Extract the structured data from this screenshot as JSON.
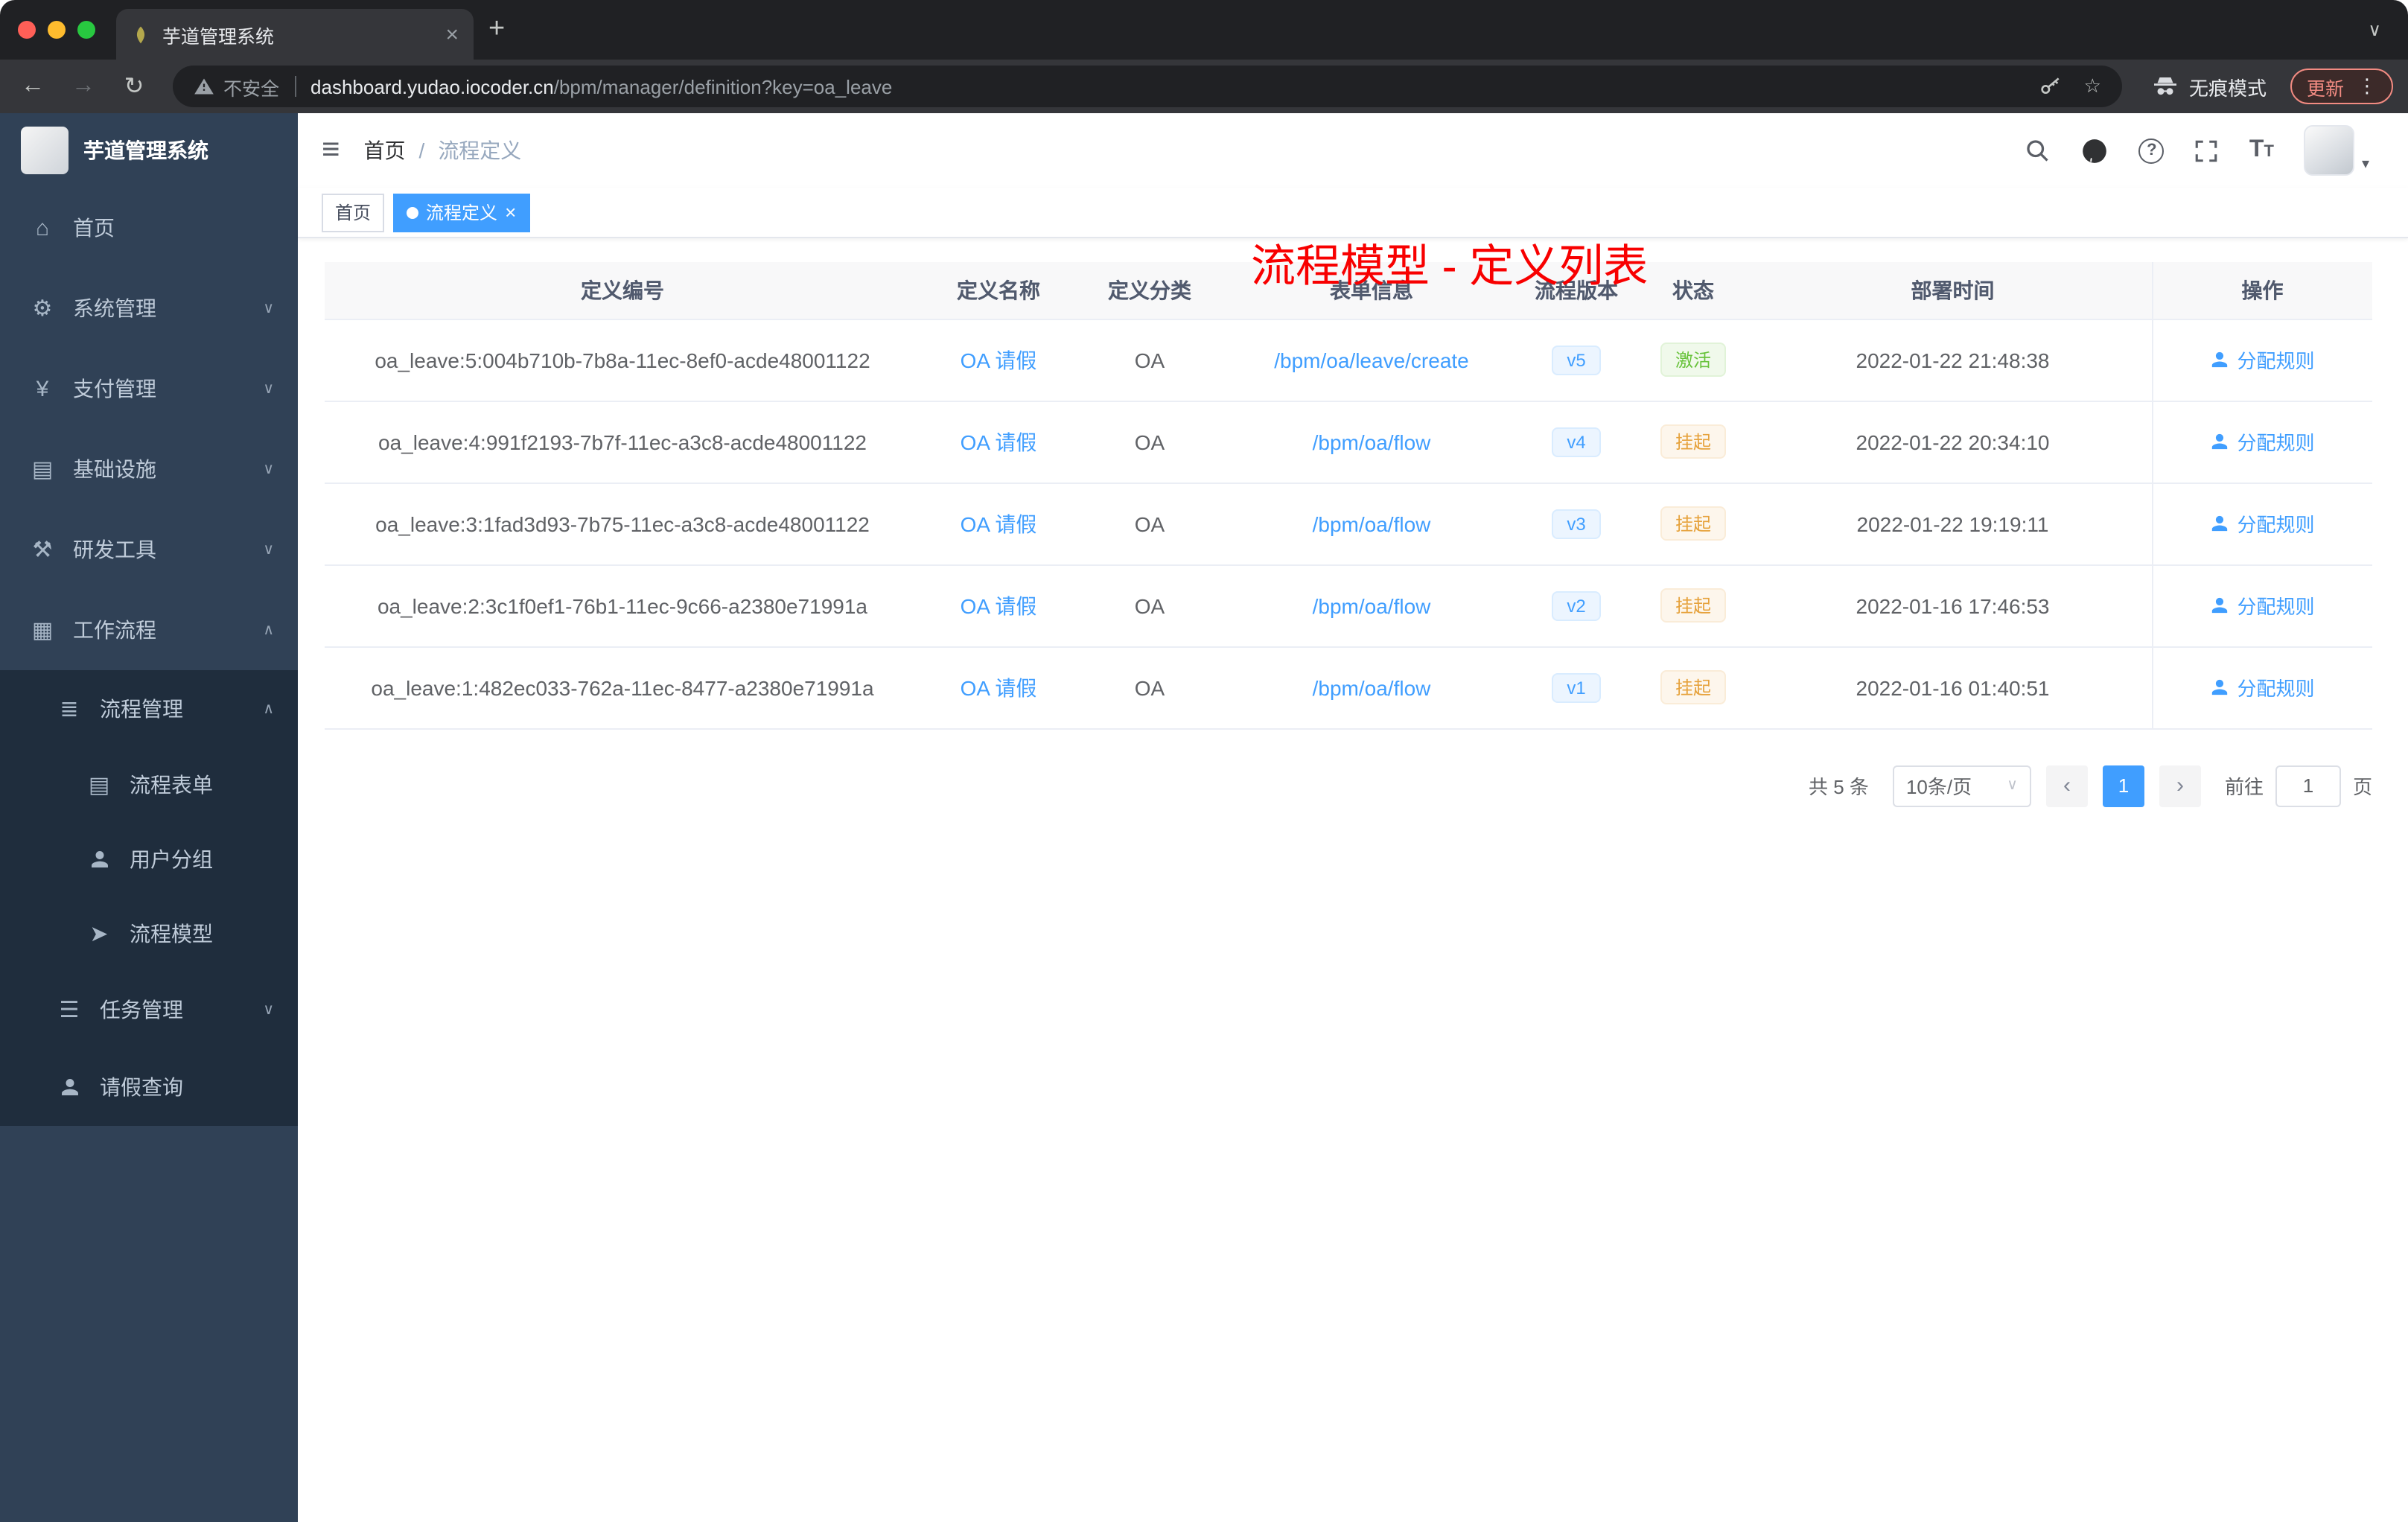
{
  "browser": {
    "tab_title": "芋道管理系统",
    "security_label": "不安全",
    "url_host": "dashboard.yudao.iocoder.cn",
    "url_path": "/bpm/manager/definition?key=oa_leave",
    "incognito_label": "无痕模式",
    "update_label": "更新"
  },
  "sidebar": {
    "title": "芋道管理系统",
    "items": [
      {
        "label": "首页"
      },
      {
        "label": "系统管理"
      },
      {
        "label": "支付管理"
      },
      {
        "label": "基础设施"
      },
      {
        "label": "研发工具"
      },
      {
        "label": "工作流程"
      },
      {
        "label": "流程管理"
      },
      {
        "label": "流程表单"
      },
      {
        "label": "用户分组"
      },
      {
        "label": "流程模型"
      },
      {
        "label": "任务管理"
      },
      {
        "label": "请假查询"
      }
    ]
  },
  "header": {
    "breadcrumb_home": "首页",
    "breadcrumb_current": "流程定义",
    "annotation": "流程模型 - 定义列表"
  },
  "tags": {
    "home": "首页",
    "active": "流程定义"
  },
  "table": {
    "columns": [
      "定义编号",
      "定义名称",
      "定义分类",
      "表单信息",
      "流程版本",
      "状态",
      "部署时间",
      "操作"
    ],
    "rows": [
      {
        "id": "oa_leave:5:004b710b-7b8a-11ec-8ef0-acde48001122",
        "name": "OA 请假",
        "category": "OA",
        "form": "/bpm/oa/leave/create",
        "version": "v5",
        "status": "激活",
        "status_type": "success",
        "time": "2022-01-22 21:48:38",
        "action": "分配规则"
      },
      {
        "id": "oa_leave:4:991f2193-7b7f-11ec-a3c8-acde48001122",
        "name": "OA 请假",
        "category": "OA",
        "form": "/bpm/oa/flow",
        "version": "v4",
        "status": "挂起",
        "status_type": "warning",
        "time": "2022-01-22 20:34:10",
        "action": "分配规则"
      },
      {
        "id": "oa_leave:3:1fad3d93-7b75-11ec-a3c8-acde48001122",
        "name": "OA 请假",
        "category": "OA",
        "form": "/bpm/oa/flow",
        "version": "v3",
        "status": "挂起",
        "status_type": "warning",
        "time": "2022-01-22 19:19:11",
        "action": "分配规则"
      },
      {
        "id": "oa_leave:2:3c1f0ef1-76b1-11ec-9c66-a2380e71991a",
        "name": "OA 请假",
        "category": "OA",
        "form": "/bpm/oa/flow",
        "version": "v2",
        "status": "挂起",
        "status_type": "warning",
        "time": "2022-01-16 17:46:53",
        "action": "分配规则"
      },
      {
        "id": "oa_leave:1:482ec033-762a-11ec-8477-a2380e71991a",
        "name": "OA 请假",
        "category": "OA",
        "form": "/bpm/oa/flow",
        "version": "v1",
        "status": "挂起",
        "status_type": "warning",
        "time": "2022-01-16 01:40:51",
        "action": "分配规则"
      }
    ]
  },
  "pagination": {
    "total": "共 5 条",
    "page_size": "10条/页",
    "current": "1",
    "goto_label": "前往",
    "goto_value": "1",
    "unit": "页"
  },
  "colors": {
    "accent": "#409eff",
    "success": "#67c23a",
    "warning": "#e6a23c",
    "annotation_red": "#ff0000"
  },
  "icons": {
    "close": "×",
    "plus": "+",
    "chevron_down": "∨",
    "chevron_up": "∧",
    "back": "←",
    "forward": "→",
    "reload": "↻",
    "star": "☆",
    "more": "⋮",
    "caret_down": "▾",
    "slash": "/",
    "hamburger": "≡",
    "question": "?",
    "prev": "‹",
    "next": "›",
    "menu_home": "⌂",
    "menu_system": "⚙",
    "menu_pay": "¥",
    "menu_infra": "▤",
    "menu_dev": "⚒",
    "menu_workflow": "▦",
    "menu_process": "≣",
    "menu_form": "▤",
    "menu_model": "➤",
    "menu_task": "☰",
    "font_large": "T",
    "font_small": "T"
  }
}
